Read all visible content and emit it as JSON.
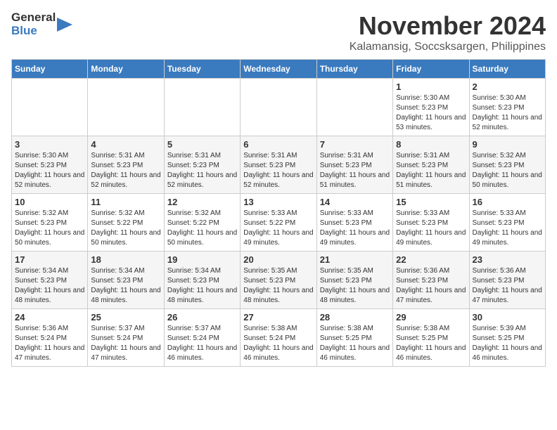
{
  "header": {
    "logo_general": "General",
    "logo_blue": "Blue",
    "month_title": "November 2024",
    "location": "Kalamansig, Soccsksargen, Philippines"
  },
  "weekdays": [
    "Sunday",
    "Monday",
    "Tuesday",
    "Wednesday",
    "Thursday",
    "Friday",
    "Saturday"
  ],
  "weeks": [
    [
      {
        "day": "",
        "info": ""
      },
      {
        "day": "",
        "info": ""
      },
      {
        "day": "",
        "info": ""
      },
      {
        "day": "",
        "info": ""
      },
      {
        "day": "",
        "info": ""
      },
      {
        "day": "1",
        "info": "Sunrise: 5:30 AM\nSunset: 5:23 PM\nDaylight: 11 hours and 53 minutes."
      },
      {
        "day": "2",
        "info": "Sunrise: 5:30 AM\nSunset: 5:23 PM\nDaylight: 11 hours and 52 minutes."
      }
    ],
    [
      {
        "day": "3",
        "info": "Sunrise: 5:30 AM\nSunset: 5:23 PM\nDaylight: 11 hours and 52 minutes."
      },
      {
        "day": "4",
        "info": "Sunrise: 5:31 AM\nSunset: 5:23 PM\nDaylight: 11 hours and 52 minutes."
      },
      {
        "day": "5",
        "info": "Sunrise: 5:31 AM\nSunset: 5:23 PM\nDaylight: 11 hours and 52 minutes."
      },
      {
        "day": "6",
        "info": "Sunrise: 5:31 AM\nSunset: 5:23 PM\nDaylight: 11 hours and 52 minutes."
      },
      {
        "day": "7",
        "info": "Sunrise: 5:31 AM\nSunset: 5:23 PM\nDaylight: 11 hours and 51 minutes."
      },
      {
        "day": "8",
        "info": "Sunrise: 5:31 AM\nSunset: 5:23 PM\nDaylight: 11 hours and 51 minutes."
      },
      {
        "day": "9",
        "info": "Sunrise: 5:32 AM\nSunset: 5:23 PM\nDaylight: 11 hours and 50 minutes."
      }
    ],
    [
      {
        "day": "10",
        "info": "Sunrise: 5:32 AM\nSunset: 5:23 PM\nDaylight: 11 hours and 50 minutes."
      },
      {
        "day": "11",
        "info": "Sunrise: 5:32 AM\nSunset: 5:22 PM\nDaylight: 11 hours and 50 minutes."
      },
      {
        "day": "12",
        "info": "Sunrise: 5:32 AM\nSunset: 5:22 PM\nDaylight: 11 hours and 50 minutes."
      },
      {
        "day": "13",
        "info": "Sunrise: 5:33 AM\nSunset: 5:22 PM\nDaylight: 11 hours and 49 minutes."
      },
      {
        "day": "14",
        "info": "Sunrise: 5:33 AM\nSunset: 5:23 PM\nDaylight: 11 hours and 49 minutes."
      },
      {
        "day": "15",
        "info": "Sunrise: 5:33 AM\nSunset: 5:23 PM\nDaylight: 11 hours and 49 minutes."
      },
      {
        "day": "16",
        "info": "Sunrise: 5:33 AM\nSunset: 5:23 PM\nDaylight: 11 hours and 49 minutes."
      }
    ],
    [
      {
        "day": "17",
        "info": "Sunrise: 5:34 AM\nSunset: 5:23 PM\nDaylight: 11 hours and 48 minutes."
      },
      {
        "day": "18",
        "info": "Sunrise: 5:34 AM\nSunset: 5:23 PM\nDaylight: 11 hours and 48 minutes."
      },
      {
        "day": "19",
        "info": "Sunrise: 5:34 AM\nSunset: 5:23 PM\nDaylight: 11 hours and 48 minutes."
      },
      {
        "day": "20",
        "info": "Sunrise: 5:35 AM\nSunset: 5:23 PM\nDaylight: 11 hours and 48 minutes."
      },
      {
        "day": "21",
        "info": "Sunrise: 5:35 AM\nSunset: 5:23 PM\nDaylight: 11 hours and 48 minutes."
      },
      {
        "day": "22",
        "info": "Sunrise: 5:36 AM\nSunset: 5:23 PM\nDaylight: 11 hours and 47 minutes."
      },
      {
        "day": "23",
        "info": "Sunrise: 5:36 AM\nSunset: 5:23 PM\nDaylight: 11 hours and 47 minutes."
      }
    ],
    [
      {
        "day": "24",
        "info": "Sunrise: 5:36 AM\nSunset: 5:24 PM\nDaylight: 11 hours and 47 minutes."
      },
      {
        "day": "25",
        "info": "Sunrise: 5:37 AM\nSunset: 5:24 PM\nDaylight: 11 hours and 47 minutes."
      },
      {
        "day": "26",
        "info": "Sunrise: 5:37 AM\nSunset: 5:24 PM\nDaylight: 11 hours and 46 minutes."
      },
      {
        "day": "27",
        "info": "Sunrise: 5:38 AM\nSunset: 5:24 PM\nDaylight: 11 hours and 46 minutes."
      },
      {
        "day": "28",
        "info": "Sunrise: 5:38 AM\nSunset: 5:25 PM\nDaylight: 11 hours and 46 minutes."
      },
      {
        "day": "29",
        "info": "Sunrise: 5:38 AM\nSunset: 5:25 PM\nDaylight: 11 hours and 46 minutes."
      },
      {
        "day": "30",
        "info": "Sunrise: 5:39 AM\nSunset: 5:25 PM\nDaylight: 11 hours and 46 minutes."
      }
    ]
  ]
}
